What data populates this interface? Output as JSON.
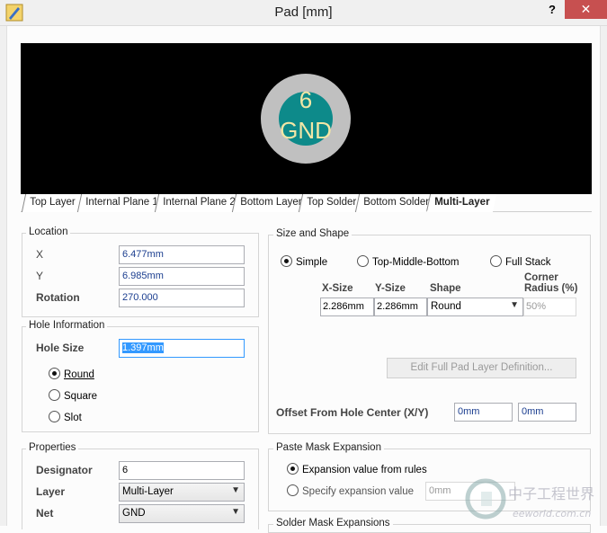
{
  "window": {
    "title": "Pad [mm]",
    "help": "?",
    "close": "✕"
  },
  "preview": {
    "pad_number": "6",
    "net_name": "GND",
    "colors": {
      "background": "#000000",
      "copper": "#c0c0c0",
      "hole": "#0d8a8a",
      "text": "#f2e6a6"
    }
  },
  "layer_tabs": [
    "Top Layer",
    "Internal Plane 1",
    "Internal Plane 2",
    "Bottom Layer",
    "Top Solder",
    "Bottom Solder",
    "Multi-Layer"
  ],
  "active_tab": "Multi-Layer",
  "location": {
    "group_label": "Location",
    "x_label": "X",
    "x_value": "6.477mm",
    "y_label": "Y",
    "y_value": "6.985mm",
    "rotation_label": "Rotation",
    "rotation_value": "270.000"
  },
  "hole": {
    "group_label": "Hole Information",
    "size_label": "Hole Size",
    "size_value": "1.397mm",
    "options": [
      "Round",
      "Square",
      "Slot"
    ],
    "selected": "Round"
  },
  "properties": {
    "group_label": "Properties",
    "designator_label": "Designator",
    "designator_value": "6",
    "layer_label": "Layer",
    "layer_value": "Multi-Layer",
    "net_label": "Net",
    "net_value": "GND"
  },
  "size_shape": {
    "group_label": "Size and Shape",
    "modes": [
      "Simple",
      "Top-Middle-Bottom",
      "Full Stack"
    ],
    "selected_mode": "Simple",
    "columns": [
      "X-Size",
      "Y-Size",
      "Shape",
      "Corner",
      "Radius (%)"
    ],
    "x_size": "2.286mm",
    "y_size": "2.286mm",
    "shape": "Round",
    "corner_radius": "50%",
    "edit_button": "Edit Full Pad Layer Definition...",
    "offset_label": "Offset From Hole Center (X/Y)",
    "offset_x": "0mm",
    "offset_y": "0mm"
  },
  "paste_mask": {
    "group_label": "Paste Mask Expansion",
    "option_rules": "Expansion value from rules",
    "option_specify": "Specify expansion value",
    "specify_value": "0mm",
    "selected": "Expansion value from rules"
  },
  "solder_mask": {
    "group_label": "Solder Mask Expansions"
  }
}
